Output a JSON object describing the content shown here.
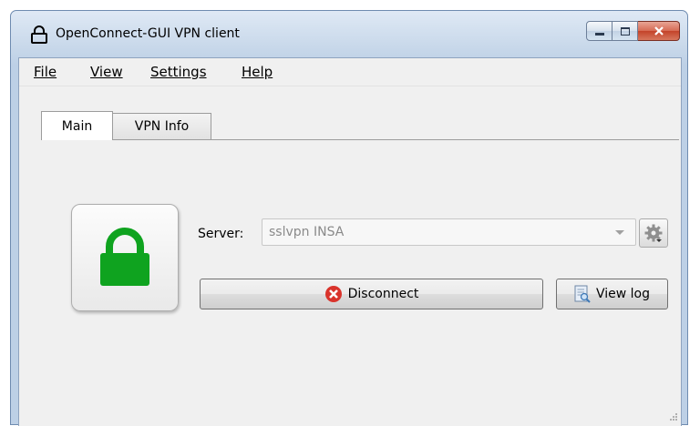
{
  "window": {
    "title": "OpenConnect-GUI VPN client"
  },
  "menu": {
    "items": [
      "File",
      "View",
      "Settings",
      "Help"
    ]
  },
  "tabs": {
    "main": "Main",
    "vpn_info": "VPN Info"
  },
  "connection": {
    "server_label": "Server:",
    "server_value": "sslvpn INSA",
    "disconnect_label": "Disconnect",
    "view_log_label": "View log"
  },
  "colors": {
    "lock_green": "#0fa31f",
    "disconnect_icon": "#d9332b"
  },
  "icons": [
    "lock-icon",
    "disconnect-icon",
    "gear-icon",
    "log-icon"
  ]
}
